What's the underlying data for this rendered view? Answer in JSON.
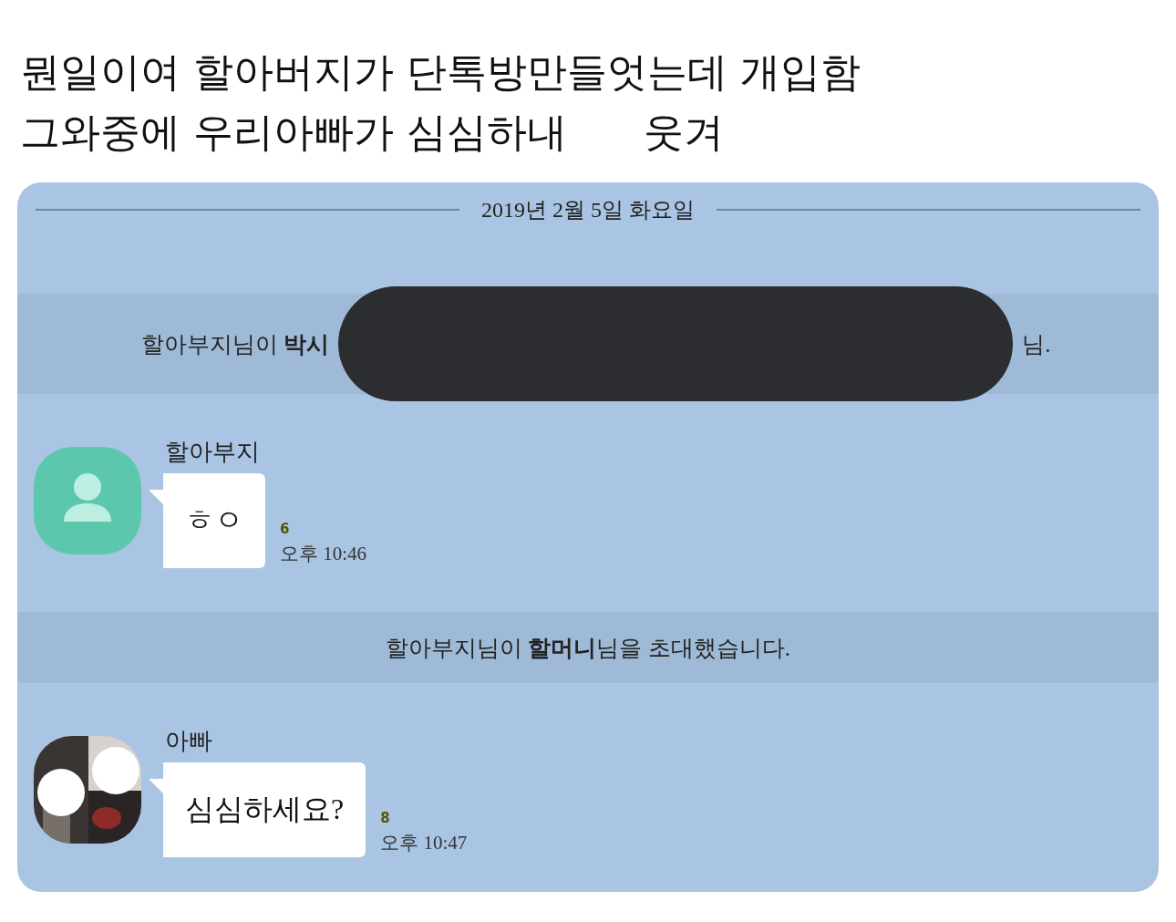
{
  "caption": {
    "lines": [
      "뭔일이여 할아버지가 단톡방만들엇는데 개입함",
      "그와중에 우리아빠가 심심하내      웃겨"
    ]
  },
  "chat": {
    "items": [
      {
        "kind": "date",
        "text": "2019년 2월 5일 화요일"
      },
      {
        "kind": "system",
        "text": "할아부지님이 **박시**",
        "tail": "님.",
        "redacted": true
      },
      {
        "kind": "message",
        "avatar": {
          "kind": "icon"
        },
        "name": "할아부지",
        "text": "ㅎㅇ",
        "unread": "6",
        "time": "오후 10:46"
      },
      {
        "kind": "system",
        "text": "할아부지님이 **할머니**님을 초대했습니다.",
        "redacted": false
      },
      {
        "kind": "message",
        "name": "아빠",
        "text": "심심하세요?",
        "unread": "8",
        "time": "오후 10:47"
      }
    ]
  }
}
